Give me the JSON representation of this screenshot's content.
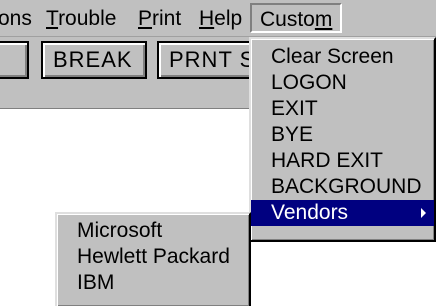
{
  "menubar": {
    "items": [
      {
        "label_pre": "",
        "label_ul": "",
        "label_post": "ons"
      },
      {
        "label_pre": "",
        "label_ul": "T",
        "label_post": "rouble"
      },
      {
        "label_pre": "",
        "label_ul": "P",
        "label_post": "rint"
      },
      {
        "label_pre": "",
        "label_ul": "H",
        "label_post": "elp"
      },
      {
        "label_pre": "Custo",
        "label_ul": "m",
        "label_post": ""
      }
    ]
  },
  "toolbar": {
    "buttons": [
      {
        "label": ""
      },
      {
        "label": "BREAK"
      },
      {
        "label": "PRNT S"
      }
    ]
  },
  "custom_menu": {
    "items": [
      {
        "label": "Clear Screen"
      },
      {
        "label": "LOGON"
      },
      {
        "label": "EXIT"
      },
      {
        "label": "BYE"
      },
      {
        "label": "HARD EXIT"
      },
      {
        "label": "BACKGROUND"
      },
      {
        "label": "Vendors",
        "submenu_icon": "right-arrow-icon"
      }
    ]
  },
  "vendors_menu": {
    "items": [
      {
        "label": "Microsoft"
      },
      {
        "label": "Hewlett Packard"
      },
      {
        "label": "IBM"
      }
    ]
  },
  "colors": {
    "face": "#c0c0c0",
    "highlight": "#000080",
    "highlight_text": "#ffffff"
  }
}
